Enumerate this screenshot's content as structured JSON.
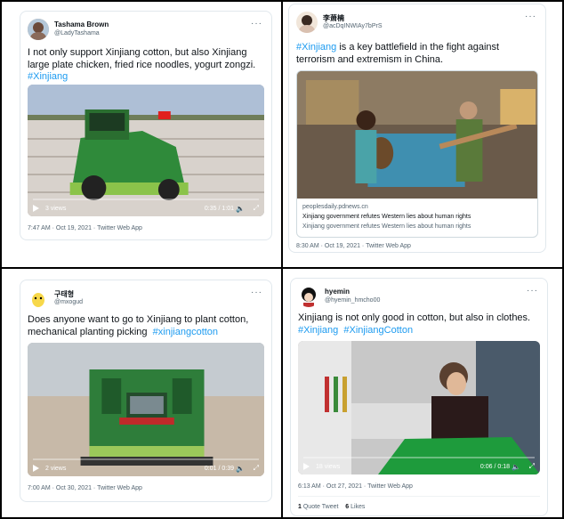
{
  "tweets": [
    {
      "name": "Tashama Brown",
      "handle": "@LadyTashama",
      "text": "I not only support Xinjiang cotton, but also Xinjiang large plate chicken, fried rice noodles, yogurt zongzi.",
      "hashtags": [
        "#Xinjiang"
      ],
      "video": {
        "views": "3 views",
        "time": "0:35 / 1:01"
      },
      "meta": "7:47 AM · Oct 19, 2021 · Twitter Web App"
    },
    {
      "name": "李萧楠",
      "handle": "@acDqINWIAy7bPrS",
      "hashtag": "#Xinjiang",
      "text": " is a key battlefield in the fight against terrorism and extremism in China.",
      "link": {
        "domain": "peoplesdaily.pdnews.cn",
        "title": "Xinjiang government refutes Western lies about human rights",
        "desc": "Xinjiang government refutes Western lies about human rights"
      },
      "meta": "8:30 AM · Oct 19, 2021 · Twitter Web App"
    },
    {
      "name": "구태형",
      "handle": "@mxogud",
      "text": "Does anyone want to go to Xinjiang to plant cotton, mechanical planting picking",
      "hashtag": "#xinjiangcotton",
      "video": {
        "views": "2 views",
        "time": "0:01 / 0:39"
      },
      "meta": "7:00 AM · Oct 30, 2021 · Twitter Web App"
    },
    {
      "name": "hyemin",
      "handle": "@hyemin_hmcho00",
      "text": "Xinjiang is not only good in cotton, but also in clothes.",
      "hashtags": [
        "#Xinjiang",
        "#XinjiangCotton"
      ],
      "video": {
        "views": "18 views",
        "time": "0:06 / 0:18"
      },
      "meta": "6:13 AM · Oct 27, 2021 · Twitter Web App",
      "stats": {
        "quote_count": "1",
        "quote_label": "Quote Tweet",
        "like_count": "6",
        "like_label": "Likes"
      }
    }
  ],
  "ui": {
    "more": "···",
    "play_icon": "play-icon",
    "volume_icon": "volume-icon",
    "fullscreen_icon": "fullscreen-icon"
  }
}
